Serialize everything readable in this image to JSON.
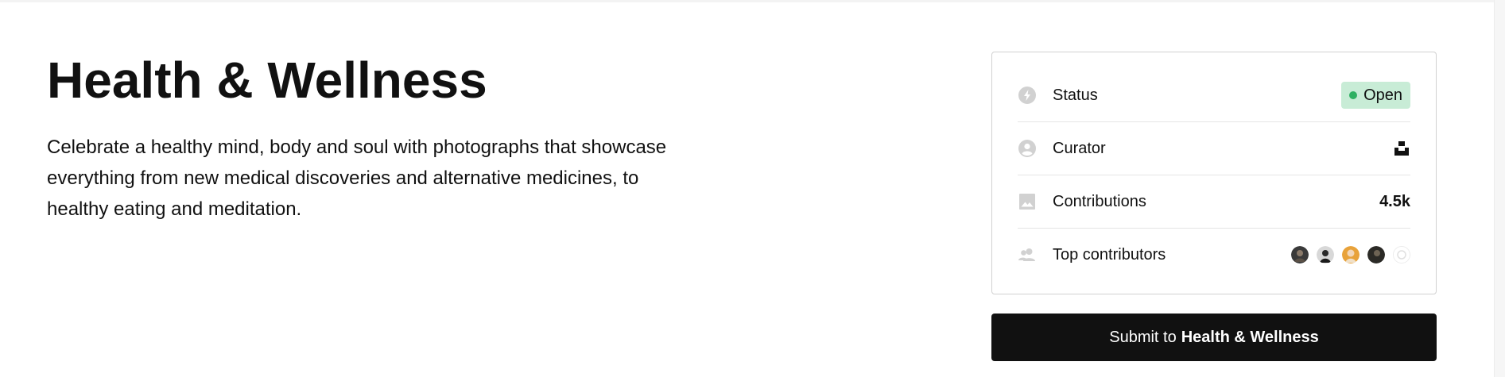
{
  "hero": {
    "title": "Health & Wellness",
    "description": "Celebrate a healthy mind, body and soul with photographs that showcase everything from new medical discoveries and alternative medicines, to healthy eating and meditation."
  },
  "info_card": {
    "status": {
      "label": "Status",
      "value": "Open",
      "icon": "bolt-icon",
      "badge_color": "#c8ecd6",
      "dot_color": "#2fb062"
    },
    "curator": {
      "label": "Curator",
      "icon": "user-circle-icon",
      "logo": "unsplash-logo"
    },
    "contributions": {
      "label": "Contributions",
      "value": "4.5k",
      "icon": "image-icon"
    },
    "top_contributors": {
      "label": "Top contributors",
      "icon": "people-icon",
      "avatars": [
        "avatar-1",
        "avatar-2",
        "avatar-3",
        "avatar-4",
        "avatar-5"
      ]
    }
  },
  "submit": {
    "prefix": "Submit to",
    "topic": "Health & Wellness"
  },
  "colors": {
    "button_bg": "#111111",
    "icon_gray": "#d1d1d1"
  }
}
